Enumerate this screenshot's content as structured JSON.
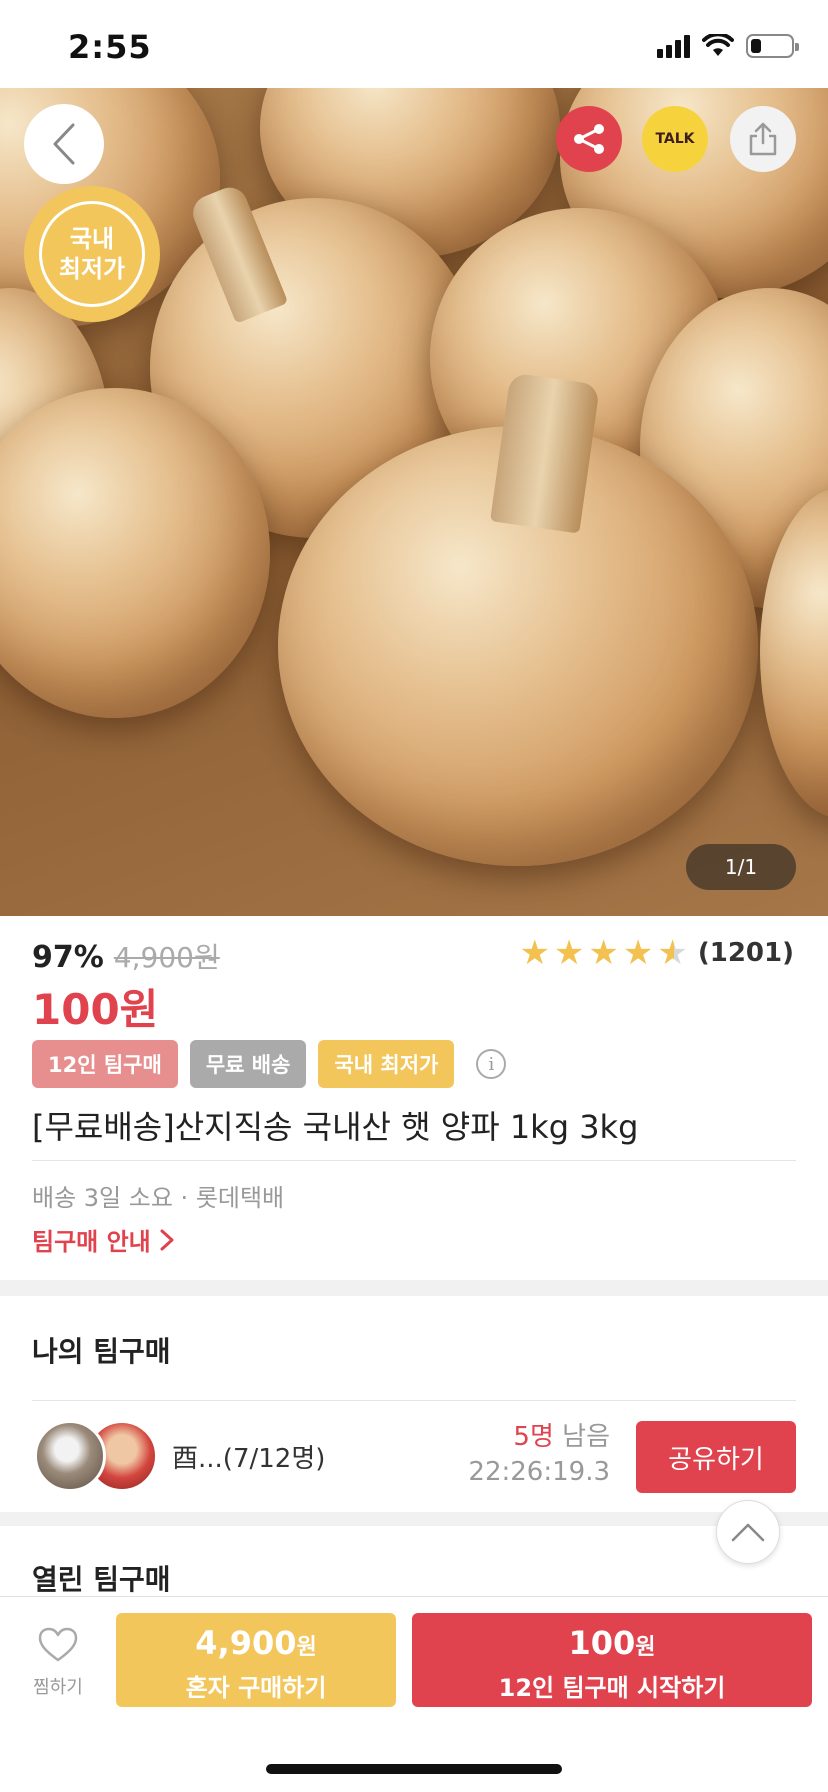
{
  "status_bar": {
    "time": "2:55",
    "battery_level": 0.25
  },
  "hero": {
    "badge_line1": "국내",
    "badge_line2": "최저가",
    "talk_label": "TALK",
    "page_indicator": "1/1"
  },
  "product": {
    "discount": "97%",
    "original_price": "4,900원",
    "sale_price": "100원",
    "rating_value": 4.5,
    "rating_count": "(1201)",
    "tags": [
      "12인 팀구매",
      "무료 배송",
      "국내 최저가"
    ],
    "info_icon": "i",
    "title": "[무료배송]산지직송 국내산 햇 양파 1kg 3kg",
    "delivery": "배송 3일 소요 · 롯데택배",
    "team_guide": "팀구매 안내"
  },
  "my_team": {
    "section_title": "나의 팀구매",
    "name": "酉...(7/12명)",
    "remaining_count": "5명",
    "remaining_label": "남음",
    "timer": "22:26:19.3",
    "share_label": "공유하기"
  },
  "open_team": {
    "section_title": "열린 팀구매"
  },
  "bottom_bar": {
    "wish_label": "찜하기",
    "solo_price": "4,900",
    "solo_unit": "원",
    "solo_label": "혼자 구매하기",
    "team_price": "100",
    "team_unit": "원",
    "team_label": "12인 팀구매 시작하기"
  },
  "colors": {
    "accent_red": "#e0434e",
    "accent_yellow": "#f2c65a",
    "kakao_yellow": "#f6d33c"
  }
}
